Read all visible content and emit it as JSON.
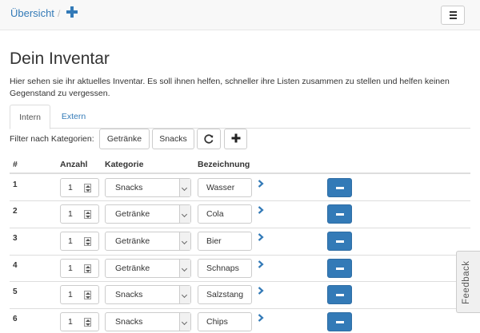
{
  "nav": {
    "breadcrumb": "Übersicht",
    "separator": "/",
    "add_icon": "plus-icon",
    "menu_icon": "hamburger-icon"
  },
  "page": {
    "title": "Dein Inventar",
    "intro": "Hier sehen sie ihr aktuelles Inventar. Es soll ihnen helfen, schneller ihre Listen zusammen zu stellen und helfen keinen Gegenstand zu vergessen."
  },
  "tabs": [
    {
      "label": "Intern",
      "active": true
    },
    {
      "label": "Extern",
      "active": false
    }
  ],
  "filter": {
    "label": "Filter nach Kategorien:",
    "categories": [
      "Getränke",
      "Snacks"
    ],
    "refresh_icon": "refresh-icon",
    "add_icon": "plus-icon"
  },
  "table": {
    "headers": [
      "#",
      "Anzahl",
      "Kategorie",
      "Bezeichnung"
    ],
    "rows": [
      {
        "num": "1",
        "anzahl": "1",
        "kategorie": "Snacks",
        "bezeichnung": "Wasser"
      },
      {
        "num": "2",
        "anzahl": "1",
        "kategorie": "Getränke",
        "bezeichnung": "Cola"
      },
      {
        "num": "3",
        "anzahl": "1",
        "kategorie": "Getränke",
        "bezeichnung": "Bier"
      },
      {
        "num": "4",
        "anzahl": "1",
        "kategorie": "Getränke",
        "bezeichnung": "Schnaps"
      },
      {
        "num": "5",
        "anzahl": "1",
        "kategorie": "Snacks",
        "bezeichnung": "Salzstang"
      },
      {
        "num": "6",
        "anzahl": "1",
        "kategorie": "Snacks",
        "bezeichnung": "Chips"
      }
    ]
  },
  "feedback": {
    "label": "Feedback"
  },
  "colors": {
    "primary": "#337ab7",
    "navbar_bg": "#f8f8f8",
    "border": "#dddddd"
  }
}
